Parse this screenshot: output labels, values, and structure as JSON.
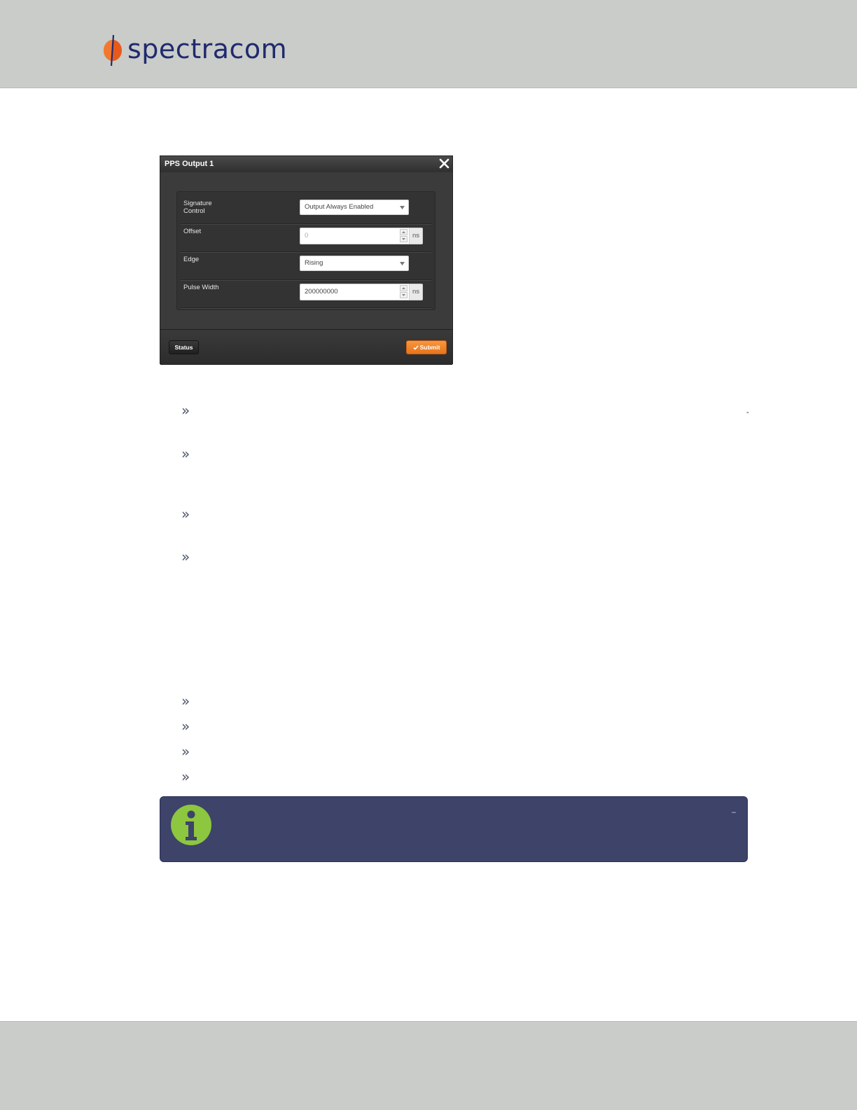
{
  "header": {
    "logo_text": "spectracom",
    "colors": {
      "band": "#c9ccc8",
      "logo_text": "#1f2a6e",
      "logo_mark": "#e85a1c"
    }
  },
  "dialog": {
    "title": "PPS Output 1",
    "close_icon": "close-icon",
    "fields": [
      {
        "label": "Signature Control",
        "type": "select",
        "value": "Output Always Enabled"
      },
      {
        "label": "Offset",
        "type": "number",
        "value": "0",
        "unit": "ns"
      },
      {
        "label": "Edge",
        "type": "select",
        "value": "Rising"
      },
      {
        "label": "Pulse Width",
        "type": "number",
        "value": "200000000",
        "unit": "ns"
      }
    ],
    "footer": {
      "status_label": "Status",
      "submit_label": "Submit",
      "submit_icon": "check-icon",
      "submit_color": "#f08a2e"
    }
  },
  "bullets": {
    "glyph": "»",
    "group1_count": 4,
    "group2_count": 4
  },
  "stray_marks": [
    "-",
    "–"
  ],
  "info_box": {
    "icon": "info-icon",
    "colors": {
      "background": "#3d4369",
      "icon": "#8dc63f"
    }
  }
}
